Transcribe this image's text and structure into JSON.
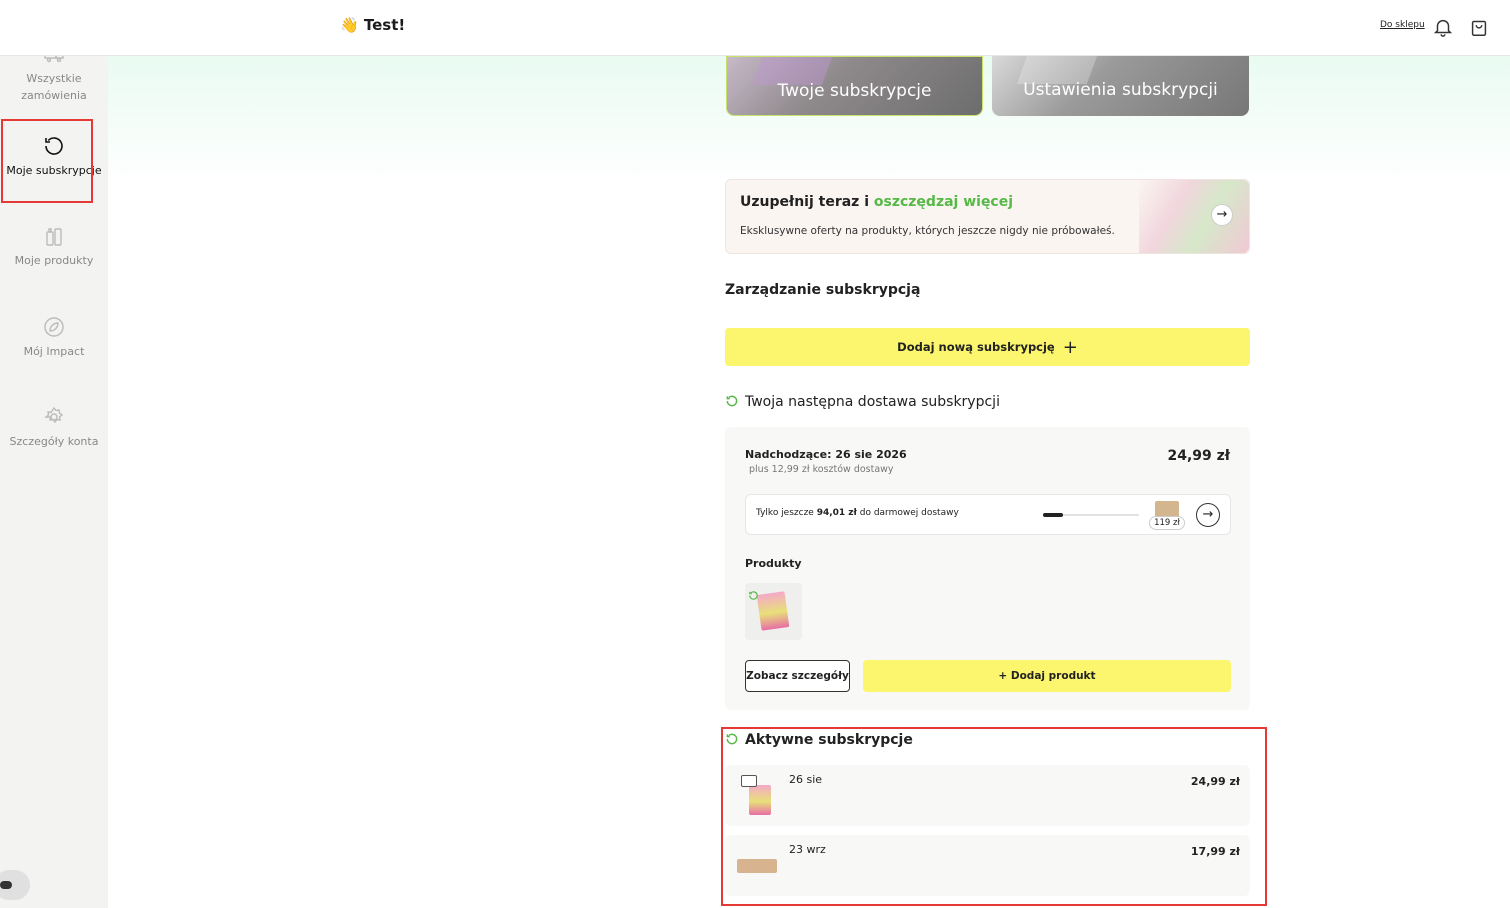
{
  "header": {
    "greeting": "👋 Test!",
    "shop_link": "Do sklepu"
  },
  "sidebar": {
    "items": [
      {
        "label": "Wszystkie zamówienia",
        "icon": "truck-icon"
      },
      {
        "label": "Moje subskrypcje",
        "icon": "refresh-icon",
        "active": true
      },
      {
        "label": "Moje produkty",
        "icon": "products-icon"
      },
      {
        "label": "Mój Impact",
        "icon": "leaf-icon"
      },
      {
        "label": "Szczegóły konta",
        "icon": "gear-icon"
      }
    ]
  },
  "tiles": {
    "your_subscriptions": "Twoje subskrypcje",
    "subscription_settings": "Ustawienia subskrypcji"
  },
  "promo": {
    "title_start": "Uzupełnij teraz i ",
    "title_highlight": "oszczędzaj więcej",
    "subtitle": "Eksklusywne oferty na produkty, których jeszcze nigdy nie próbowałeś."
  },
  "management": {
    "title": "Zarządzanie subskrypcją",
    "add_subscription": "Dodaj nową subskrypcję"
  },
  "next_delivery": {
    "title": "Twoja następna dostawa subskrypcji",
    "upcoming": "Nadchodzące: 26 sie 2026",
    "shipping": "plus 12,99 zł kosztów dostawy",
    "price": "24,99 zł",
    "free_shipping_prefix": "Tylko jeszcze ",
    "free_shipping_amount": "94,01 zł",
    "free_shipping_suffix": " do darmowej dostawy",
    "threshold_label": "119 zł",
    "progress_fraction": 0.21,
    "products_title": "Produkty",
    "details_button": "Zobacz szczegóły",
    "add_product_button": "+ Dodaj produkt"
  },
  "active_subscriptions": {
    "title": "Aktywne subskrypcje",
    "rows": [
      {
        "date": "26 sie",
        "price": "24,99 zł"
      },
      {
        "date": "23 wrz",
        "price": "17,99 zł"
      }
    ]
  },
  "colors": {
    "accent_yellow": "#fbf66e",
    "accent_green": "#56b947",
    "highlight_red": "#e53935"
  }
}
